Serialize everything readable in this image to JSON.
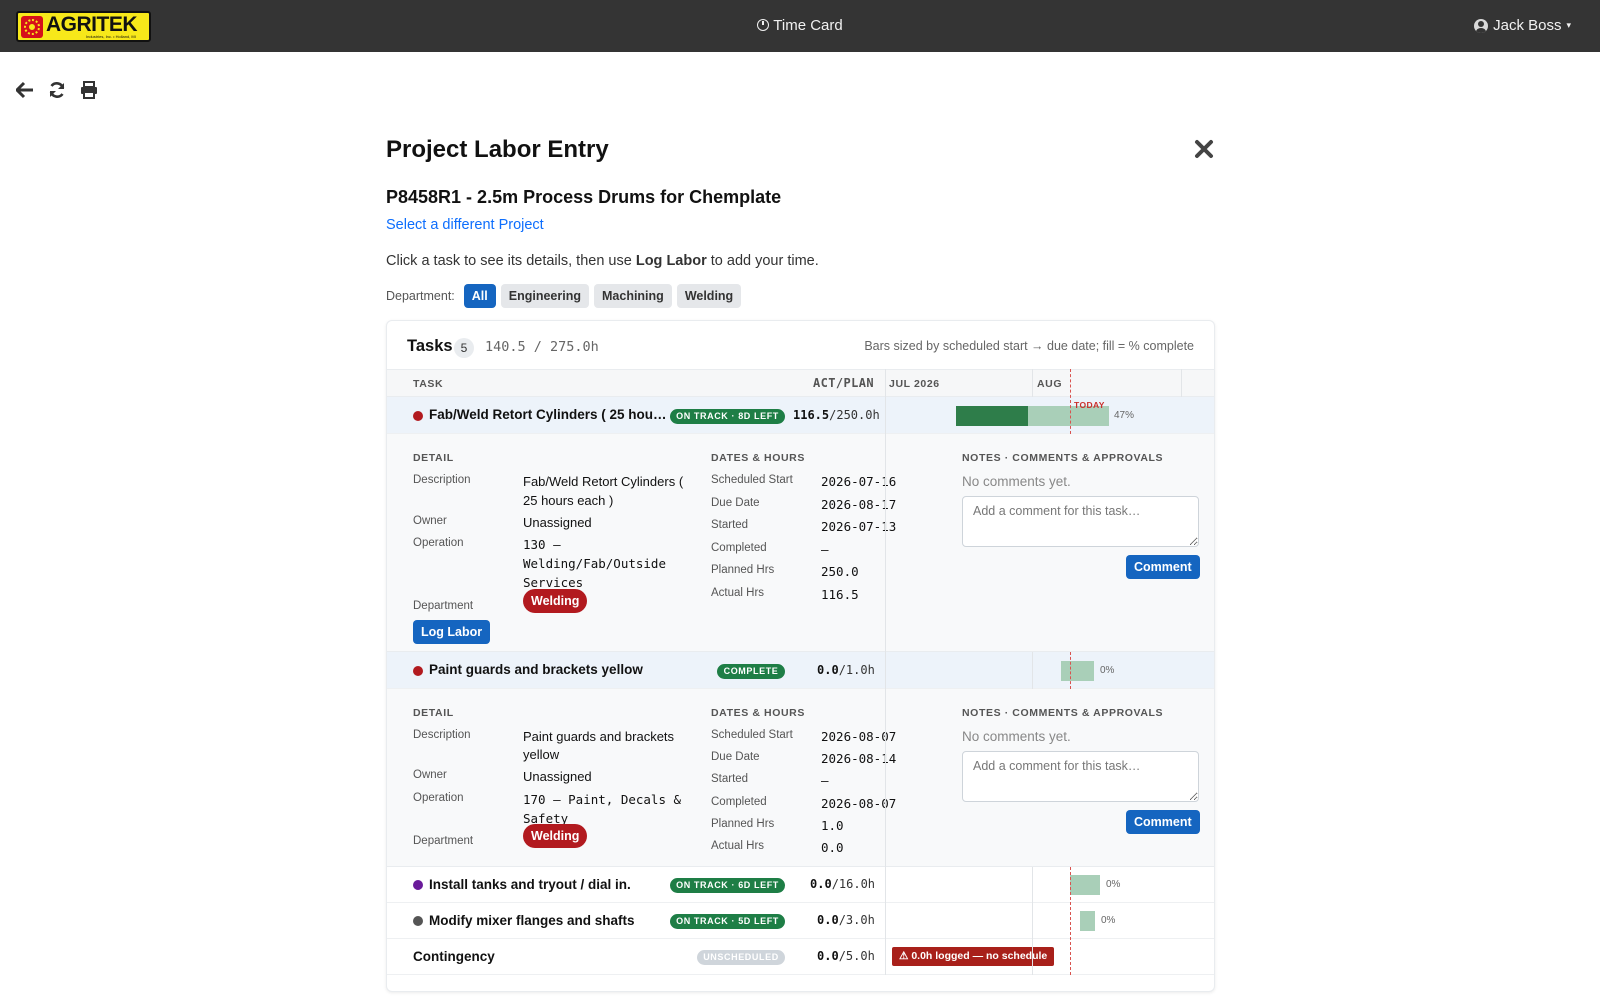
{
  "app": {
    "logo_text": "AGRITEK",
    "logo_subtext": "Industries, Inc. • Holland, MI",
    "title": "Time Card",
    "user": "Jack Boss",
    "icons": {
      "back": "arrow-left-icon",
      "refresh": "refresh-icon",
      "print": "printer-icon",
      "close": "close-icon"
    }
  },
  "page": {
    "title": "Project Labor Entry",
    "project": "P8458R1 - 2.5m Process Drums for Chemplate",
    "change_link": "Select a different Project",
    "instruction_pre": "Click a task to see its details, then use ",
    "instruction_bold": "Log Labor",
    "instruction_post": " to add your time."
  },
  "departments": {
    "label": "Department:",
    "options": [
      "All",
      "Engineering",
      "Machining",
      "Welding"
    ],
    "selected": "All"
  },
  "tasks_card": {
    "title": "Tasks",
    "count": "5",
    "totals": "140.5 / 275.0h",
    "note": "Bars sized by scheduled start → due date; fill = % complete",
    "columns": {
      "task": "TASK",
      "act_plan": "ACT/PLAN",
      "month1": "JUL 2026",
      "month2": "AUG"
    },
    "today_label": "TODAY"
  },
  "tasks": [
    {
      "name": "Fab/Weld Retort Cylinders ( 25 hou…",
      "status": "ON TRACK · 8D LEFT",
      "actual": "116.5",
      "plan": "/250.0h",
      "percent_label": "47%",
      "percent": 0.47,
      "dot_color": "#b21a1f"
    },
    {
      "name": "Paint guards and brackets yellow",
      "status": "COMPLETE",
      "actual": "0.0",
      "plan": "/1.0h",
      "percent_label": "0%",
      "percent": 0,
      "dot_color": "#b21a1f"
    },
    {
      "name": "Install tanks and tryout / dial in.",
      "status": "ON TRACK · 6D LEFT",
      "actual": "0.0",
      "plan": "/16.0h",
      "percent_label": "0%",
      "percent": 0,
      "dot_color": "#6a1b9a"
    },
    {
      "name": "Modify mixer flanges and shafts",
      "status": "ON TRACK · 5D LEFT",
      "actual": "0.0",
      "plan": "/3.0h",
      "percent_label": "0%",
      "percent": 0,
      "dot_color": "#555555"
    },
    {
      "name": "Contingency",
      "status": "UNSCHEDULED",
      "actual": "0.0",
      "plan": "/5.0h",
      "warning": "⚠ 0.0h logged — no schedule"
    }
  ],
  "details": [
    {
      "section_detail": "DETAIL",
      "section_dates": "DATES & HOURS",
      "section_notes": "NOTES · COMMENTS & APPROVALS",
      "labels": {
        "description": "Description",
        "owner": "Owner",
        "operation": "Operation",
        "department": "Department",
        "sched_start": "Scheduled Start",
        "due_date": "Due Date",
        "started": "Started",
        "completed": "Completed",
        "planned": "Planned Hrs",
        "actual": "Actual Hrs"
      },
      "description_l1": "Fab/Weld Retort Cylinders (",
      "description_l2": "25 hours each )",
      "owner": "Unassigned",
      "operation_l1": "130 –",
      "operation_l2": "Welding/Fab/Outside",
      "operation_l3": "Services",
      "department": "Welding",
      "sched_start": "2026-07-16",
      "due_date": "2026-08-17",
      "started": "2026-07-13",
      "completed": "–",
      "planned": "250.0",
      "actual": "116.5",
      "no_comments": "No comments yet.",
      "comment_placeholder": "Add a comment for this task…",
      "comment_button": "Comment",
      "log_button": "Log Labor"
    },
    {
      "section_detail": "DETAIL",
      "section_dates": "DATES & HOURS",
      "section_notes": "NOTES · COMMENTS & APPROVALS",
      "labels": {
        "description": "Description",
        "owner": "Owner",
        "operation": "Operation",
        "department": "Department",
        "sched_start": "Scheduled Start",
        "due_date": "Due Date",
        "started": "Started",
        "completed": "Completed",
        "planned": "Planned Hrs",
        "actual": "Actual Hrs"
      },
      "description_l1": "Paint guards and brackets",
      "description_l2": "yellow",
      "owner": "Unassigned",
      "operation_l1": "170 – Paint, Decals &",
      "operation_l2": "Safety",
      "department": "Welding",
      "sched_start": "2026-08-07",
      "due_date": "2026-08-14",
      "started": "–",
      "completed": "2026-08-07",
      "planned": "1.0",
      "actual": "0.0",
      "no_comments": "No comments yet.",
      "comment_placeholder": "Add a comment for this task…",
      "comment_button": "Comment"
    }
  ]
}
